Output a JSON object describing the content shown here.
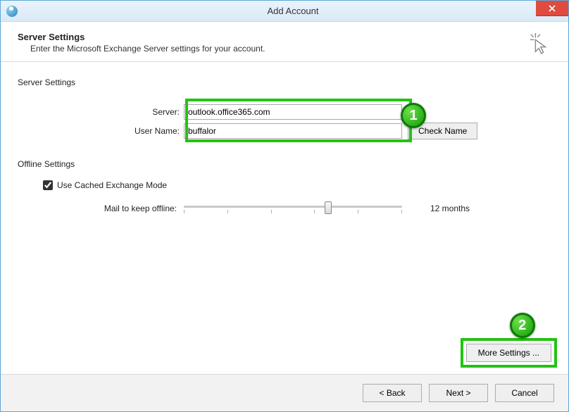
{
  "window": {
    "title": "Add Account"
  },
  "header": {
    "title": "Server Settings",
    "subtitle": "Enter the Microsoft Exchange Server settings for your account."
  },
  "server_settings": {
    "section_label": "Server Settings",
    "server_label": "Server:",
    "server_value": "outlook.office365.com",
    "username_label": "User Name:",
    "username_value": "buffalor",
    "check_name_label": "Check Name"
  },
  "offline_settings": {
    "section_label": "Offline Settings",
    "cached_mode_label": "Use Cached Exchange Mode",
    "cached_mode_checked": true,
    "mail_offline_label": "Mail to keep offline:",
    "mail_offline_value": "12 months"
  },
  "more_settings_label": "More Settings ...",
  "footer": {
    "back": "<  Back",
    "next": "Next  >",
    "cancel": "Cancel"
  },
  "annotations": {
    "badge1": "1",
    "badge2": "2"
  }
}
